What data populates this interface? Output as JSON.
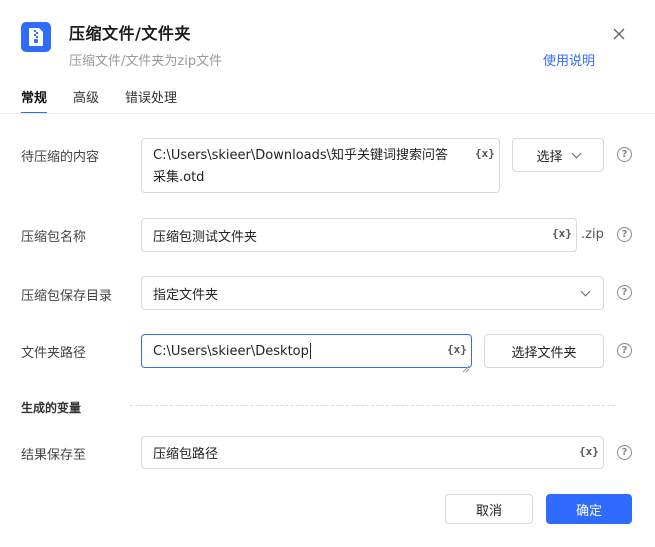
{
  "header": {
    "title": "压缩文件/文件夹",
    "subtitle": "压缩文件/文件夹为zip文件",
    "help_link": "使用说明"
  },
  "tabs": [
    {
      "label": "常规",
      "active": true
    },
    {
      "label": "高级",
      "active": false
    },
    {
      "label": "错误处理",
      "active": false
    }
  ],
  "form": {
    "content": {
      "label": "待压缩的内容",
      "value_line1": "C:\\Users\\skieer\\Downloads\\知乎关键词搜索问答",
      "value_line2": "采集.otd",
      "select_label": "选择"
    },
    "archive_name": {
      "label": "压缩包名称",
      "value": "压缩包测试文件夹",
      "suffix": ".zip"
    },
    "save_dir": {
      "label": "压缩包保存目录",
      "value": "指定文件夹"
    },
    "folder_path": {
      "label": "文件夹路径",
      "value": "C:\\Users\\skieer\\Desktop",
      "select_label": "选择文件夹"
    }
  },
  "generated_vars": {
    "section_title": "生成的变量",
    "result": {
      "label": "结果保存至",
      "value": "压缩包路径"
    }
  },
  "variable_button": "{x}",
  "footer": {
    "cancel": "取消",
    "confirm": "确定"
  },
  "colors": {
    "accent": "#2f6bff"
  }
}
